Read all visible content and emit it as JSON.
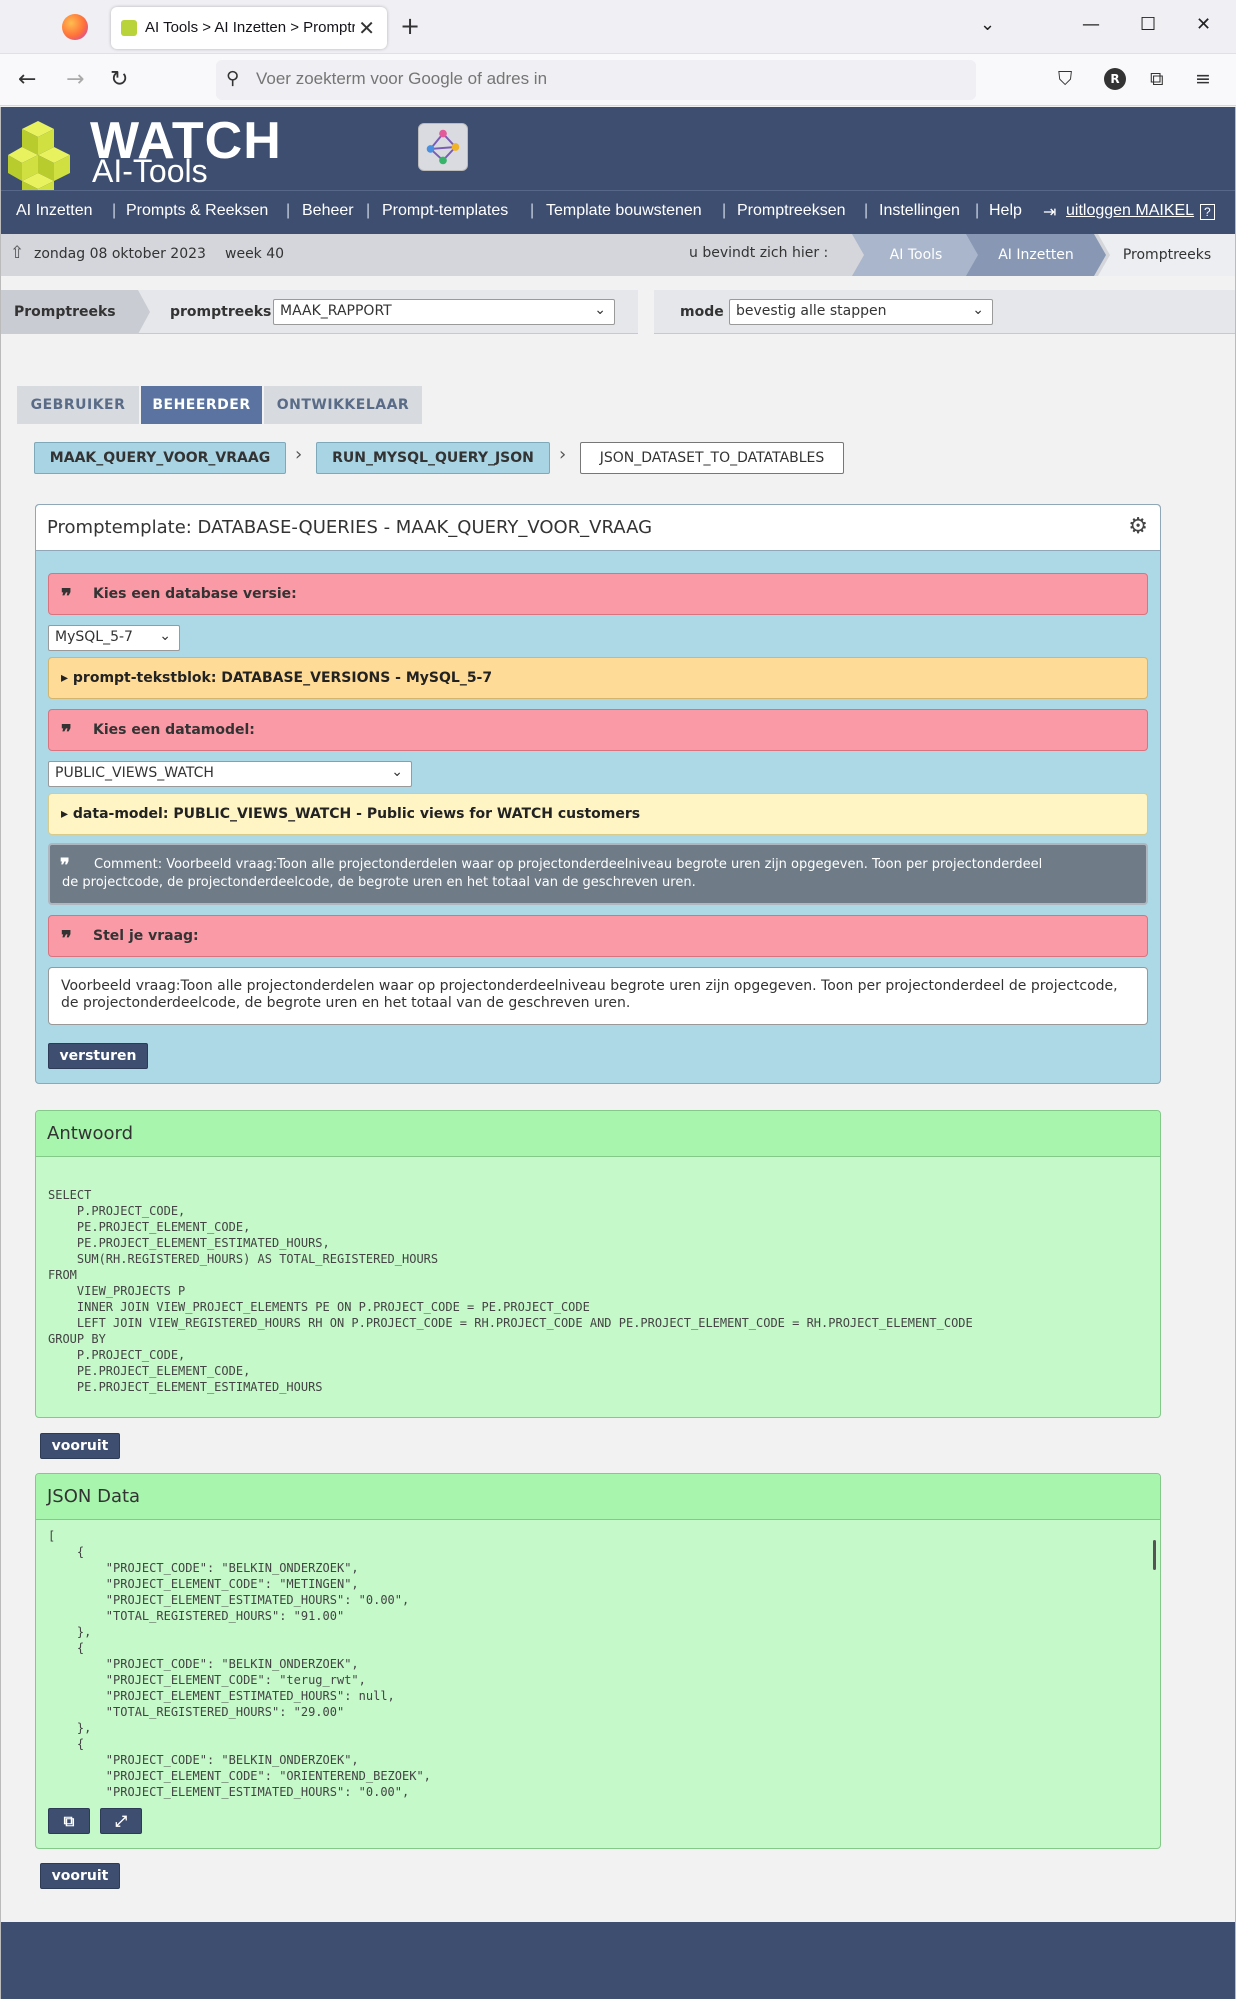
{
  "browser": {
    "tab_title": "AI Tools > AI Inzetten > Promptreeks",
    "url_placeholder": "Voer zoekterm voor Google of adres in",
    "avatar_letter": "R"
  },
  "header": {
    "logo_main": "WATCH",
    "logo_sub": "AI-Tools"
  },
  "menu": {
    "items": [
      "AI Inzetten",
      "Prompts & Reeksen",
      "Beheer",
      "Prompt-templates",
      "Template bouwstenen",
      "Promptreeksen",
      "Instellingen",
      "Help"
    ],
    "logout": "uitloggen MAIKEL"
  },
  "breadcrumb": {
    "date": "zondag 08 oktober 2023",
    "week": "week 40",
    "here_label": "u bevindt zich hier :",
    "crumbs": [
      "AI Tools",
      "AI Inzetten",
      "Promptreeks"
    ]
  },
  "promptbar": {
    "first": "Promptreeks",
    "promptreeks_label": "promptreeks",
    "promptreeks_value": "MAAK_RAPPORT",
    "mode_label": "mode",
    "mode_value": "bevestig alle stappen"
  },
  "role_tabs": [
    "GEBRUIKER",
    "BEHEERDER",
    "ONTWIKKELAAR"
  ],
  "steps": [
    "MAAK_QUERY_VOOR_VRAAG",
    "RUN_MYSQL_QUERY_JSON",
    "JSON_DATASET_TO_DATATABLES"
  ],
  "prompt_panel": {
    "title": "Promptemplate: DATABASE-QUERIES - MAAK_QUERY_VOOR_VRAAG",
    "db_version_label": "Kies een database versie:",
    "db_version_value": "MySQL_5-7",
    "textblock": "▸ prompt-tekstblok: DATABASE_VERSIONS - MySQL_5-7",
    "datamodel_label": "Kies een datamodel:",
    "datamodel_value": "PUBLIC_VIEWS_WATCH",
    "datamodel_info": "▸ data-model: PUBLIC_VIEWS_WATCH - Public views for WATCH customers",
    "comment_line1": "Comment: Voorbeeld vraag:Toon alle projectonderdelen waar op projectonderdeelniveau begrote uren zijn opgegeven. Toon per projectonderdeel",
    "comment_line2": "de projectcode, de projectonderdeelcode, de begrote uren en het totaal van de geschreven uren.",
    "question_label": "Stel je vraag:",
    "question_line1": "Voorbeeld vraag:Toon alle projectonderdelen waar op projectonderdeelniveau begrote uren zijn opgegeven. Toon per projectonderdeel de projectcode,",
    "question_line2": "de projectonderdeelcode, de begrote uren en het totaal van de geschreven uren.",
    "submit": "versturen"
  },
  "answer_panel": {
    "title": "Antwoord",
    "code": "SELECT\n    P.PROJECT_CODE,\n    PE.PROJECT_ELEMENT_CODE,\n    PE.PROJECT_ELEMENT_ESTIMATED_HOURS,\n    SUM(RH.REGISTERED_HOURS) AS TOTAL_REGISTERED_HOURS\nFROM\n    VIEW_PROJECTS P\n    INNER JOIN VIEW_PROJECT_ELEMENTS PE ON P.PROJECT_CODE = PE.PROJECT_CODE\n    LEFT JOIN VIEW_REGISTERED_HOURS RH ON P.PROJECT_CODE = RH.PROJECT_CODE AND PE.PROJECT_ELEMENT_CODE = RH.PROJECT_ELEMENT_CODE\nGROUP BY\n    P.PROJECT_CODE,\n    PE.PROJECT_ELEMENT_CODE,\n    PE.PROJECT_ELEMENT_ESTIMATED_HOURS",
    "next": "vooruit"
  },
  "json_panel": {
    "title": "JSON Data",
    "code": "[\n    {\n        \"PROJECT_CODE\": \"BELKIN_ONDERZOEK\",\n        \"PROJECT_ELEMENT_CODE\": \"METINGEN\",\n        \"PROJECT_ELEMENT_ESTIMATED_HOURS\": \"0.00\",\n        \"TOTAL_REGISTERED_HOURS\": \"91.00\"\n    },\n    {\n        \"PROJECT_CODE\": \"BELKIN_ONDERZOEK\",\n        \"PROJECT_ELEMENT_CODE\": \"terug_rwt\",\n        \"PROJECT_ELEMENT_ESTIMATED_HOURS\": null,\n        \"TOTAL_REGISTERED_HOURS\": \"29.00\"\n    },\n    {\n        \"PROJECT_CODE\": \"BELKIN_ONDERZOEK\",\n        \"PROJECT_ELEMENT_CODE\": \"ORIENTEREND_BEZOEK\",\n        \"PROJECT_ELEMENT_ESTIMATED_HOURS\": \"0.00\",",
    "next": "vooruit"
  },
  "colors": {
    "brand": "#3e4e70",
    "active_tab": "#5a73a0",
    "step_blue": "#a8d4e4",
    "red_bar": "#f99aa6",
    "green_panel": "#c5f9c9"
  }
}
